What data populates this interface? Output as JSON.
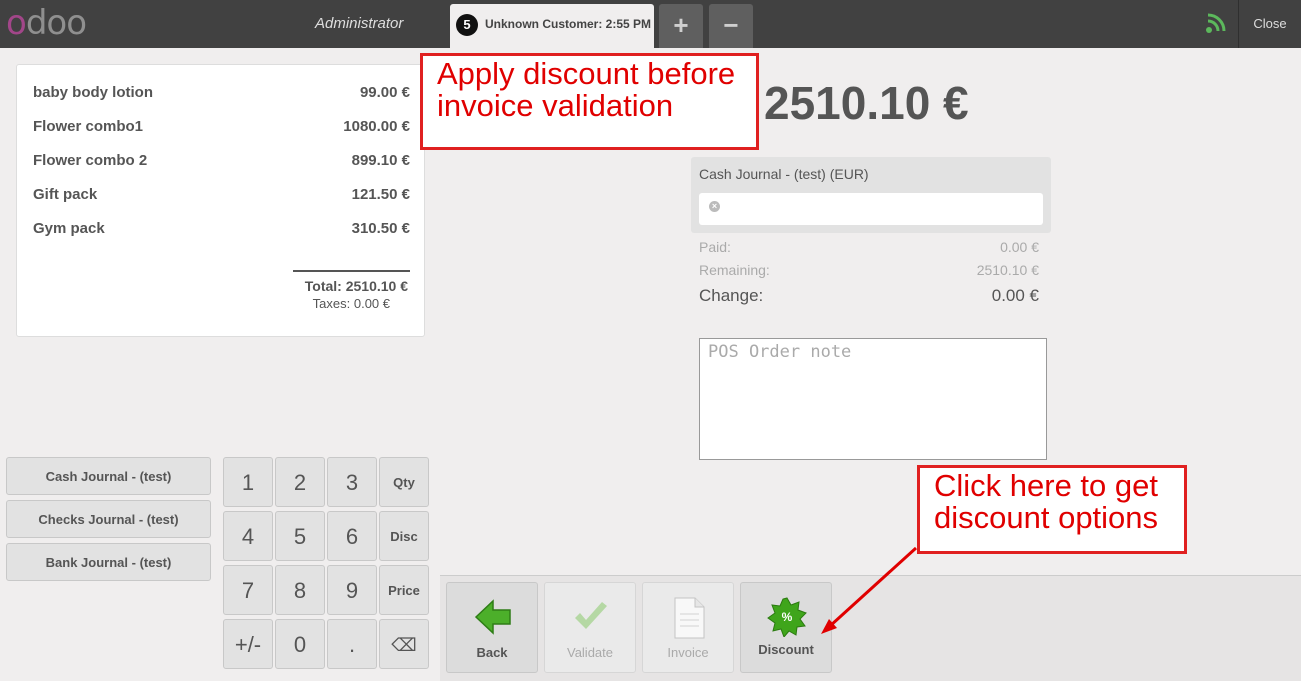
{
  "header": {
    "logo_first": "o",
    "logo_rest": "doo",
    "user": "Administrator",
    "order_number": "5",
    "order_label": "Unknown Customer: 2:55 PM",
    "add_order": "+",
    "remove_order": "−",
    "close": "Close"
  },
  "receipt": {
    "lines": [
      {
        "name": "baby body lotion",
        "price": "99.00 €"
      },
      {
        "name": "Flower combo1",
        "price": "1080.00 €"
      },
      {
        "name": "Flower combo 2",
        "price": "899.10 €"
      },
      {
        "name": "Gift pack",
        "price": "121.50 €"
      },
      {
        "name": "Gym pack",
        "price": "310.50 €"
      }
    ],
    "total": "Total: 2510.10 €",
    "taxes": "Taxes: 0.00 €"
  },
  "payment_methods": [
    "Cash Journal - (test)",
    "Checks Journal - (test)",
    "Bank Journal - (test)"
  ],
  "numpad": {
    "keys": [
      "1",
      "2",
      "3",
      "Qty",
      "4",
      "5",
      "6",
      "Disc",
      "7",
      "8",
      "9",
      "Price",
      "+/-",
      "0",
      ".",
      "⌫"
    ]
  },
  "payment": {
    "due": "2510.10 €",
    "journal": "Cash Journal - (test) (EUR)",
    "input_value": "",
    "paid_label": "Paid:",
    "paid_value": "0.00 €",
    "remaining_label": "Remaining:",
    "remaining_value": "2510.10 €",
    "change_label": "Change:",
    "change_value": "0.00 €",
    "note_placeholder": "POS Order note"
  },
  "actions": {
    "back": "Back",
    "validate": "Validate",
    "invoice": "Invoice",
    "discount": "Discount",
    "discount_badge": "%"
  },
  "annotations": {
    "top_line1": "Apply discount before",
    "top_line2": "invoice validation",
    "bottom_line1": "Click here to get",
    "bottom_line2": "discount options"
  },
  "colors": {
    "topbar": "#414141",
    "annotation": "#e00000",
    "back_arrow": "#4caf2a",
    "discount_badge": "#3fa51b"
  }
}
